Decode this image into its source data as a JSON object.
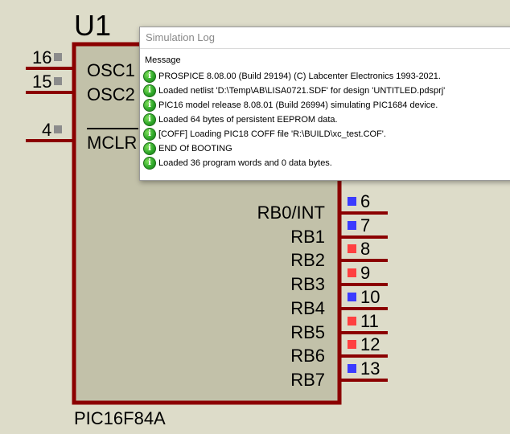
{
  "schematic": {
    "ref": "U1",
    "part": "PIC16F84A",
    "left_pins": [
      {
        "num": "16",
        "name": "OSC1"
      },
      {
        "num": "15",
        "name": "OSC2"
      },
      {
        "num": "4",
        "name": "MCLR"
      }
    ],
    "right_pins": [
      {
        "num": "6",
        "name": "RB0/INT",
        "state": "low"
      },
      {
        "num": "7",
        "name": "RB1",
        "state": "low"
      },
      {
        "num": "8",
        "name": "RB2",
        "state": "high"
      },
      {
        "num": "9",
        "name": "RB3",
        "state": "high"
      },
      {
        "num": "10",
        "name": "RB4",
        "state": "low"
      },
      {
        "num": "11",
        "name": "RB5",
        "state": "high"
      },
      {
        "num": "12",
        "name": "RB6",
        "state": "high"
      },
      {
        "num": "13",
        "name": "RB7",
        "state": "low"
      }
    ],
    "colors": {
      "wire": "#8b0000",
      "body": "#c2c1a9",
      "background": "#dddcc9",
      "pin_low": "#3b3bff",
      "pin_high": "#ff4040",
      "pin_neutral": "#8c8c8c"
    }
  },
  "log_window": {
    "title": "Simulation Log",
    "column_header": "Message",
    "entries": [
      {
        "icon": "info-icon",
        "text": "PROSPICE 8.08.00 (Build 29194) (C) Labcenter Electronics 1993-2021."
      },
      {
        "icon": "info-icon",
        "text": "Loaded netlist 'D:\\Temp\\AB\\LISA0721.SDF' for design 'UNTITLED.pdsprj'"
      },
      {
        "icon": "info-icon",
        "text": "PIC16 model release 8.08.01 (Build 26994) simulating PIC1684 device."
      },
      {
        "icon": "info-icon",
        "text": "Loaded 64 bytes of persistent EEPROM data."
      },
      {
        "icon": "info-icon",
        "text": "[COFF] Loading PIC18 COFF file 'R:\\BUILD\\xc_test.COF'."
      },
      {
        "icon": "info-icon",
        "text": "END Of BOOTING"
      },
      {
        "icon": "info-icon",
        "text": "Loaded 36 program words and 0 data bytes."
      }
    ]
  }
}
